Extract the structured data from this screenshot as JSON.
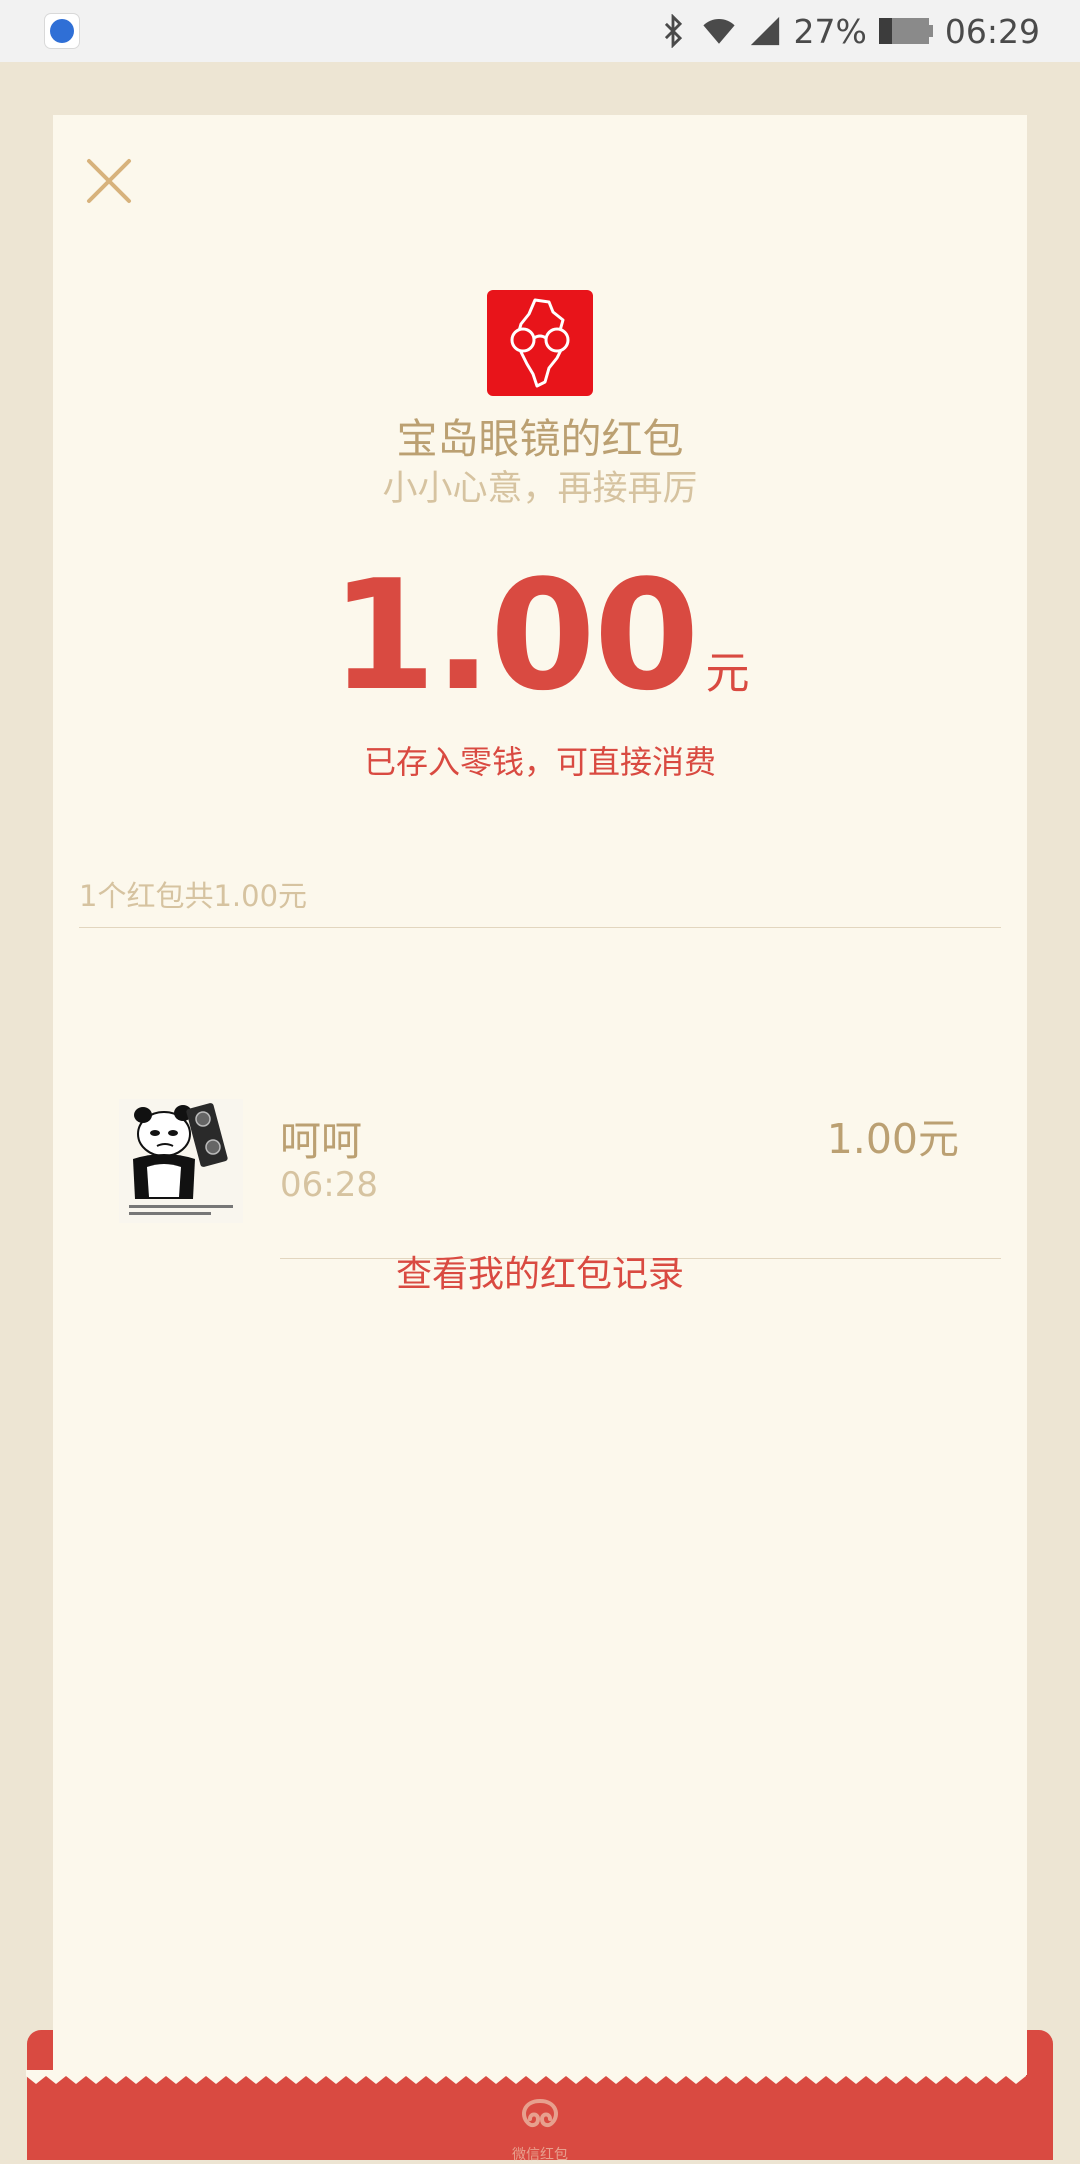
{
  "status_bar": {
    "battery_percent": "27%",
    "battery_level": 0.27,
    "time": "06:29"
  },
  "envelope": {
    "sender": "宝岛眼镜的红包",
    "wish": "小小心意，再接再厉",
    "amount": "1.00",
    "unit": "元",
    "stored_note": "已存入零钱，可直接消费",
    "summary": "1个红包共1.00元",
    "records_link": "查看我的红包记录",
    "bottom_caption": "微信红包"
  },
  "receivers": [
    {
      "name": "呵呵",
      "time": "06:28",
      "amount": "1.00元"
    }
  ],
  "colors": {
    "page_bg": "#ede5d3",
    "card_bg": "#fcf8ec",
    "accent_red": "#d94a41",
    "gold_text": "#bba072",
    "light_gold_text": "#d6c3a0",
    "logo_red": "#e8141a"
  },
  "icons": {
    "close": "close-icon",
    "bluetooth": "bluetooth-icon",
    "wifi": "wifi-icon",
    "signal": "signal-icon",
    "battery": "battery-icon"
  }
}
